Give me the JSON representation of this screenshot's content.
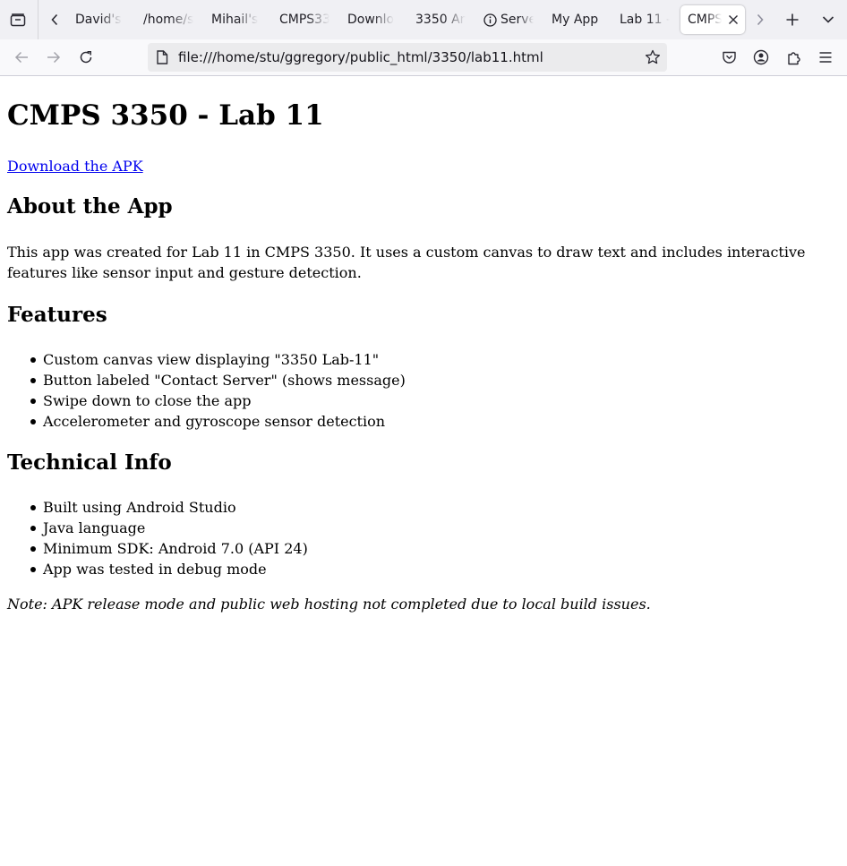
{
  "browser": {
    "tabs": [
      {
        "label": "David's"
      },
      {
        "label": "/home/s"
      },
      {
        "label": "Mihail's"
      },
      {
        "label": "CMPS33"
      },
      {
        "label": "Downlo"
      },
      {
        "label": "3350 An"
      },
      {
        "label": "Serve"
      },
      {
        "label": "My App"
      },
      {
        "label": "Lab 11 -"
      },
      {
        "label": "CMPS"
      }
    ],
    "url": "file:///home/stu/ggregory/public_html/3350/lab11.html"
  },
  "page": {
    "title": "CMPS 3350 - Lab 11",
    "download_link": "Download the APK",
    "about_heading": "About the App",
    "about_text": "This app was created for Lab 11 in CMPS 3350. It uses a custom canvas to draw text and includes interactive features like sensor input and gesture detection.",
    "features_heading": "Features",
    "features": [
      "Custom canvas view displaying \"3350 Lab-11\"",
      "Button labeled \"Contact Server\" (shows message)",
      "Swipe down to close the app",
      "Accelerometer and gyroscope sensor detection"
    ],
    "tech_heading": "Technical Info",
    "tech": [
      "Built using Android Studio",
      "Java language",
      "Minimum SDK: Android 7.0 (API 24)",
      "App was tested in debug mode"
    ],
    "note": "Note: APK release mode and public web hosting not completed due to local build issues."
  }
}
